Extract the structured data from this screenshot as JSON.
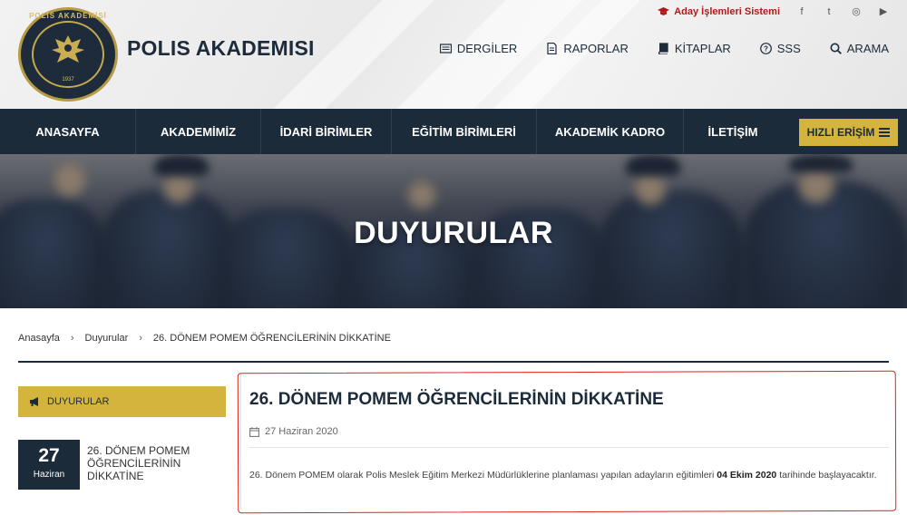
{
  "header": {
    "brand": "POLIS AKADEMISI",
    "logo_ring_text": "POLİS AKADEMİSİ",
    "logo_year": "1937",
    "aday_link": "Aday İşlemleri Sistemi",
    "social": [
      "f",
      "t",
      "◎",
      "▶"
    ],
    "social_icons": [
      "facebook-icon",
      "twitter-icon",
      "instagram-icon",
      "youtube-icon"
    ],
    "utility": [
      {
        "label": "DERGİLER",
        "icon": "magazine-icon"
      },
      {
        "label": "RAPORLAR",
        "icon": "report-icon"
      },
      {
        "label": "KİTAPLAR",
        "icon": "book-icon"
      },
      {
        "label": "SSS",
        "icon": "question-icon"
      },
      {
        "label": "ARAMA",
        "icon": "search-icon"
      }
    ]
  },
  "nav": {
    "items": [
      "ANASAYFA",
      "AKADEMİMİZ",
      "İDARİ BİRİMLER",
      "EĞİTİM BİRİMLERİ",
      "AKADEMİK KADRO",
      "İLETİŞİM"
    ],
    "quick_access": "HIZLI ERİŞİM"
  },
  "banner": {
    "title": "DUYURULAR"
  },
  "breadcrumb": [
    "Anasayfa",
    "Duyurular",
    "26. DÖNEM POMEM ÖĞRENCİLERİNİN DİKKATİNE"
  ],
  "sidebar": {
    "header": "DUYURULAR",
    "item": {
      "day": "27",
      "month": "Haziran",
      "title": "26. DÖNEM POMEM ÖĞRENCİLERİNİN DİKKATİNE"
    }
  },
  "article": {
    "title": "26. DÖNEM POMEM ÖĞRENCİLERİNİN DİKKATİNE",
    "date": "27 Haziran 2020",
    "body_before": "26. Dönem POMEM olarak Polis Meslek Eğitim Merkezi Müdürlüklerine planlaması yapılan adayların eğitimleri",
    "body_bold": "04 Ekim 2020",
    "body_after": "tarihinde başlayacaktır."
  },
  "colors": {
    "navy": "#1c2b3a",
    "gold": "#d4b43c",
    "red": "#b11a1a",
    "annotation": "#e02020"
  }
}
